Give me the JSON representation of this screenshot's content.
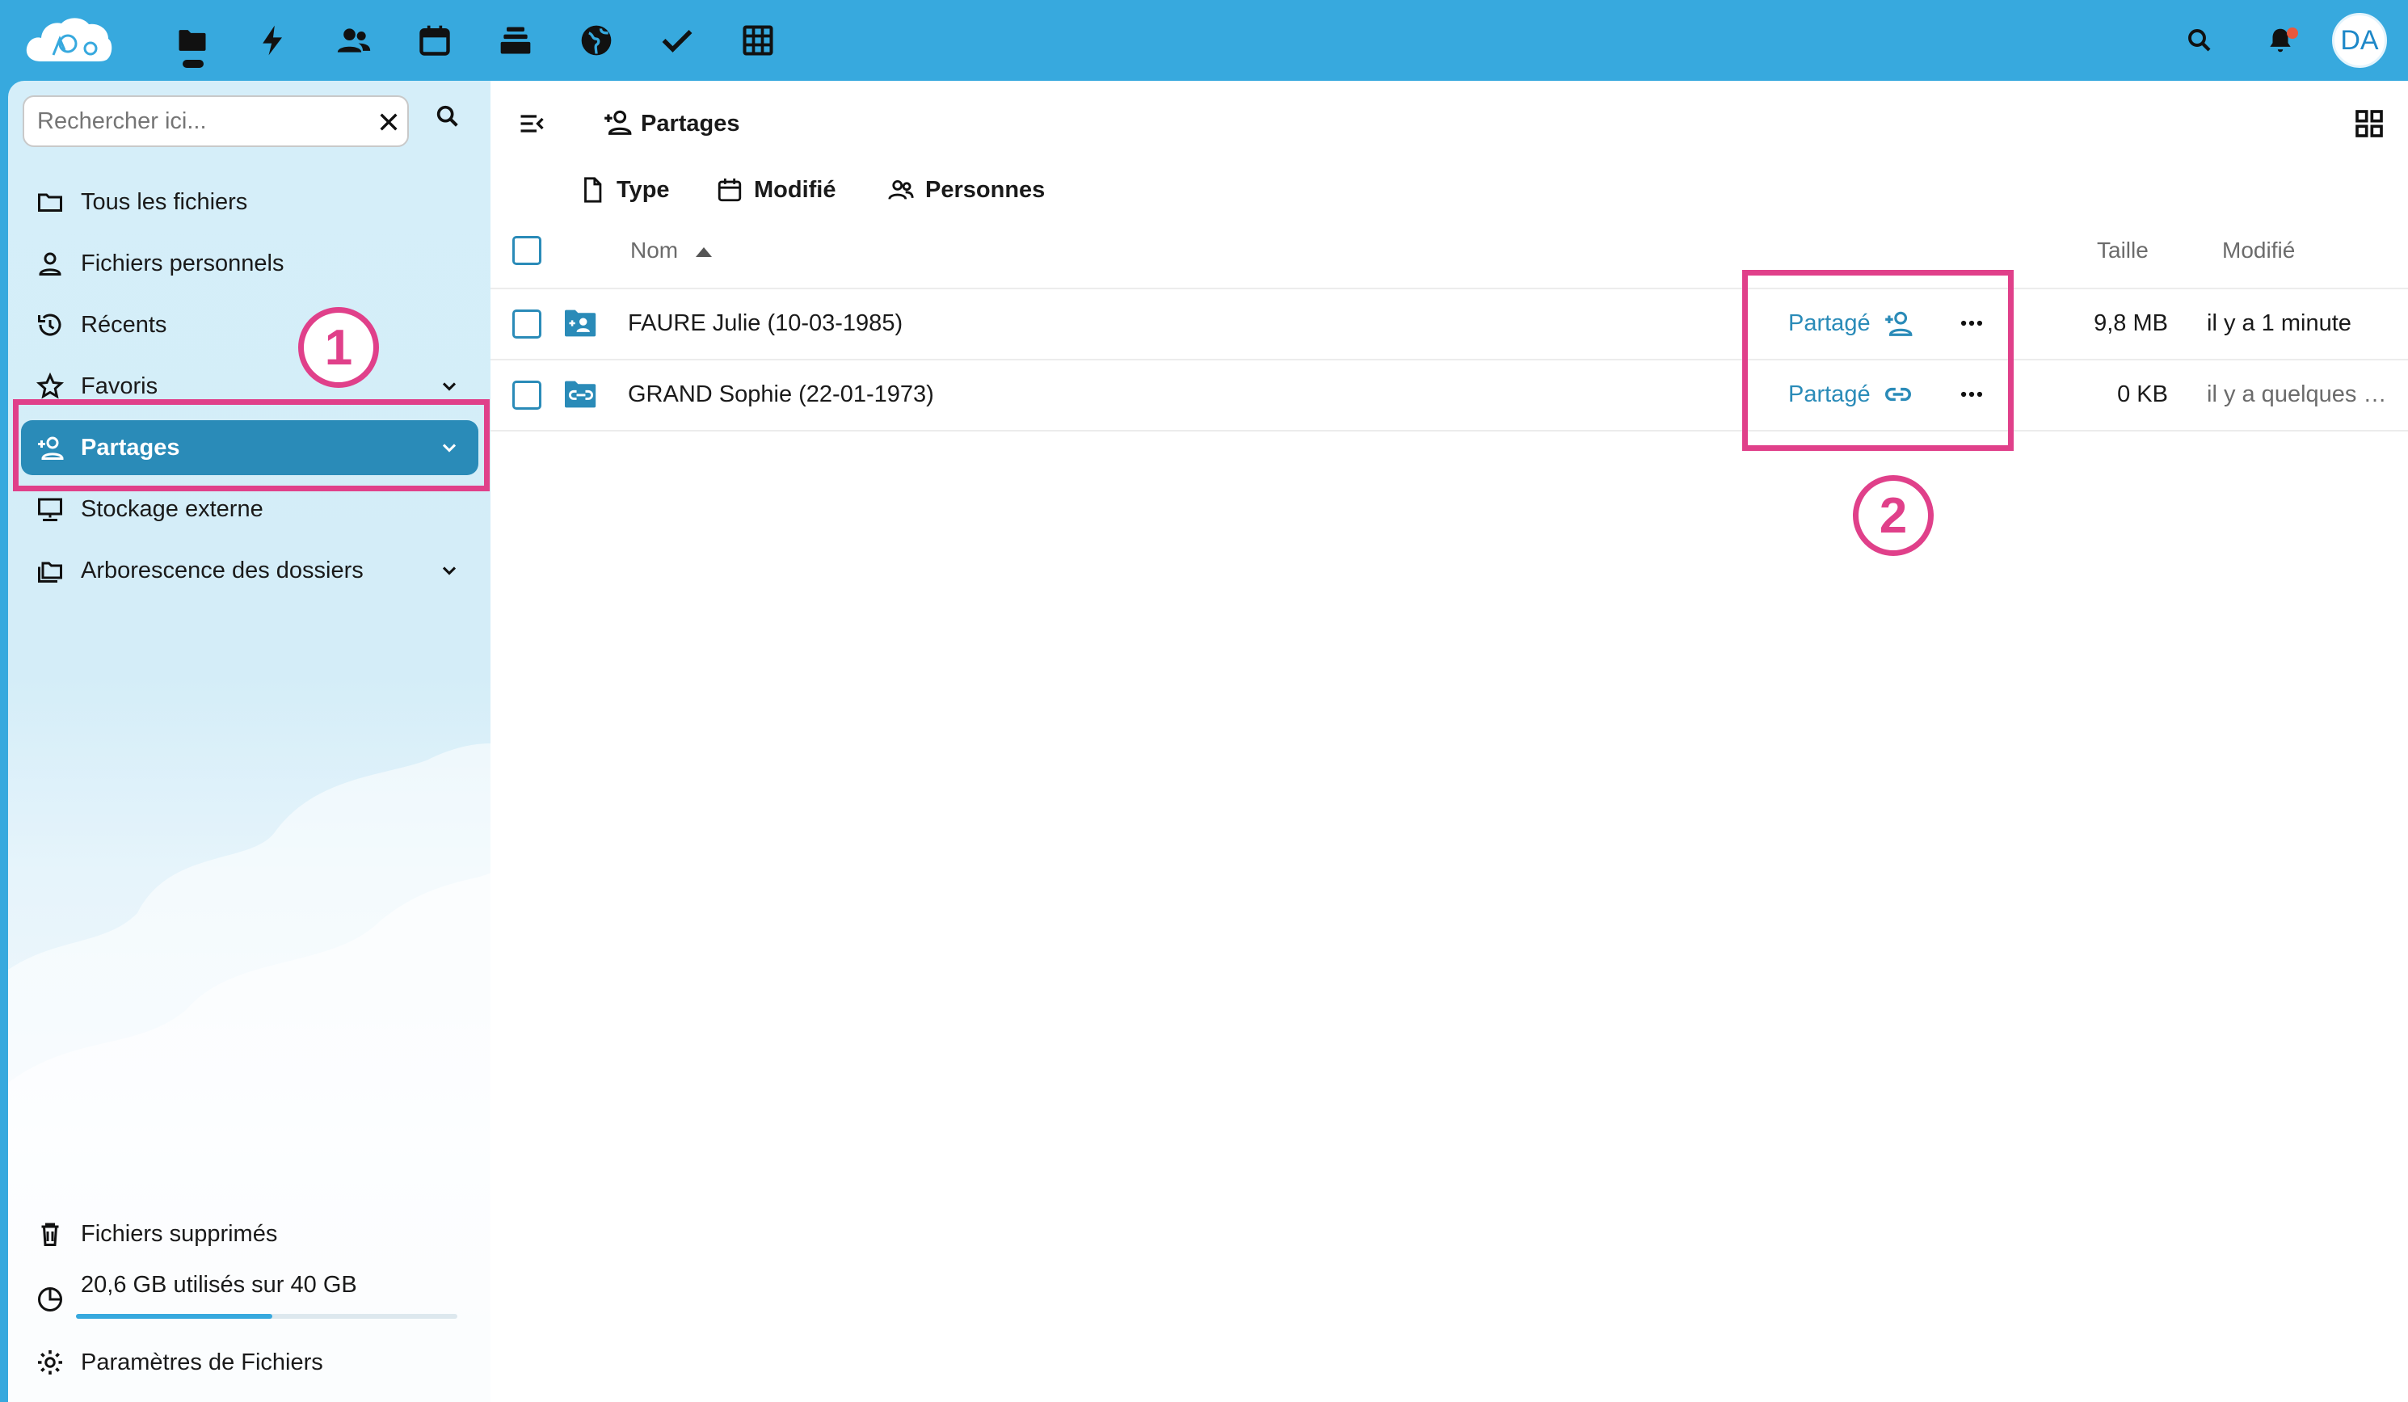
{
  "header": {
    "apps": [
      {
        "name": "files-icon"
      },
      {
        "name": "activity-icon"
      },
      {
        "name": "contacts-icon"
      },
      {
        "name": "calendar-icon"
      },
      {
        "name": "deck-icon"
      },
      {
        "name": "sites-icon"
      },
      {
        "name": "tasks-icon"
      },
      {
        "name": "tables-icon"
      }
    ],
    "avatar_initials": "DA"
  },
  "sidebar": {
    "search_placeholder": "Rechercher ici...",
    "items": [
      {
        "label": "Tous les fichiers",
        "icon": "folder-icon"
      },
      {
        "label": "Fichiers personnels",
        "icon": "person-icon"
      },
      {
        "label": "Récents",
        "icon": "history-icon"
      },
      {
        "label": "Favoris",
        "icon": "star-icon"
      },
      {
        "label": "Partages",
        "icon": "share-icon",
        "active": true
      },
      {
        "label": "Stockage externe",
        "icon": "external-storage-icon"
      },
      {
        "label": "Arborescence des dossiers",
        "icon": "folder-tree-icon"
      }
    ],
    "footer": {
      "trash_label": "Fichiers supprimés",
      "quota_label": "20,6 GB utilisés sur 40 GB",
      "quota_used_fraction": 0.515,
      "settings_label": "Paramètres de Fichiers"
    }
  },
  "main": {
    "breadcrumb": "Partages",
    "filters": [
      {
        "label": "Type",
        "icon": "file-icon"
      },
      {
        "label": "Modifié",
        "icon": "calendar-icon"
      },
      {
        "label": "Personnes",
        "icon": "people-icon"
      }
    ],
    "columns": {
      "name": "Nom",
      "size": "Taille",
      "modified": "Modifié"
    },
    "rows": [
      {
        "name": "FAURE Julie (10-03-1985)",
        "share": "Partagé",
        "share_icon": "share-user-icon",
        "size": "9,8 MB",
        "modified": "il y a 1 minute"
      },
      {
        "name": "GRAND Sophie (22-01-1973)",
        "share": "Partagé",
        "share_icon": "link-icon",
        "size": "0 KB",
        "modified": "il y a quelques …"
      }
    ]
  },
  "annotations": {
    "marker_1": "1",
    "marker_2": "2"
  },
  "colors": {
    "header": "#37a9de",
    "accent": "#2a8bb8",
    "annotation": "#e0408a"
  }
}
